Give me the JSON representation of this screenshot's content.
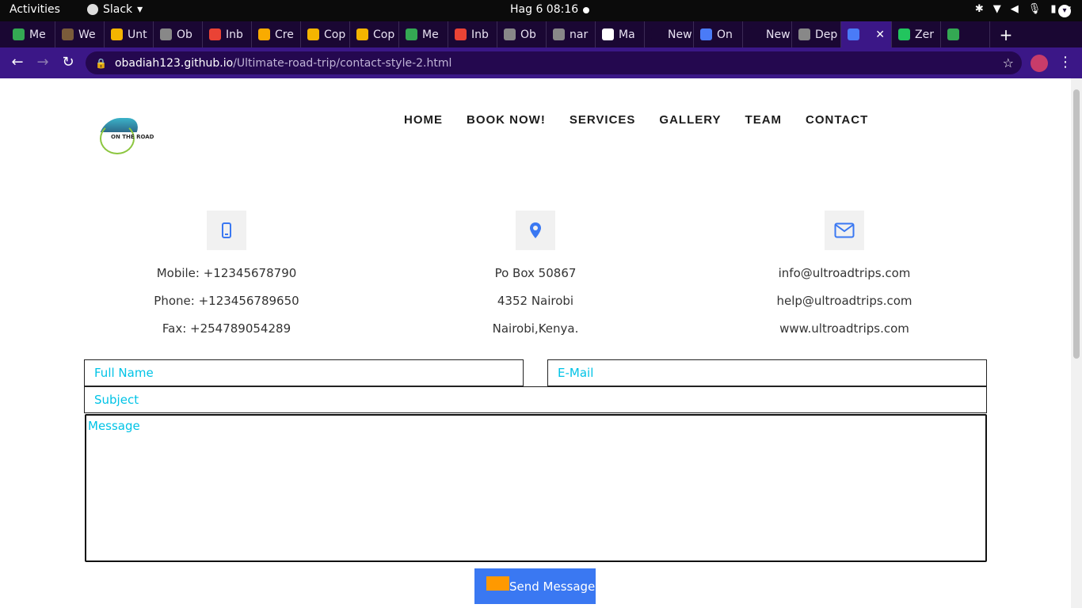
{
  "topbar": {
    "activities": "Activities",
    "app_name": "Slack",
    "clock": "Hag 6  08:16"
  },
  "tabs": [
    {
      "label": "Me",
      "color": "#34a853"
    },
    {
      "label": "We",
      "color": "#7a5b3a"
    },
    {
      "label": "Unt",
      "color": "#f4b400"
    },
    {
      "label": "Ob",
      "color": "#888888"
    },
    {
      "label": "Inb",
      "color": "#ea4335"
    },
    {
      "label": "Cre",
      "color": "#f9ab00"
    },
    {
      "label": "Cop",
      "color": "#f4b400"
    },
    {
      "label": "Cop",
      "color": "#f4b400"
    },
    {
      "label": "Me",
      "color": "#34a853"
    },
    {
      "label": "Inb",
      "color": "#ea4335"
    },
    {
      "label": "Ob",
      "color": "#888888"
    },
    {
      "label": "nar",
      "color": "#888888"
    },
    {
      "label": "Ma",
      "color": "#ffffff"
    },
    {
      "label": "New Ta",
      "color": "#1a0733"
    },
    {
      "label": "On",
      "color": "#4a7bf7"
    },
    {
      "label": "New Ta",
      "color": "#1a0733"
    },
    {
      "label": "Dep",
      "color": "#888888"
    },
    {
      "label": "",
      "color": "#4a7bf7",
      "active": true
    },
    {
      "label": "Zer",
      "color": "#22c55e"
    },
    {
      "label": "",
      "color": "#34a853"
    }
  ],
  "address": {
    "host": "obadiah123.github.io",
    "path": "/Ultimate-road-trip/contact-style-2.html"
  },
  "site": {
    "logo_text": "ON THE ROAD",
    "nav": [
      "HOME",
      "BOOK NOW!",
      "SERVICES",
      "GALLERY",
      "TEAM",
      "CONTACT"
    ],
    "contact_columns": [
      {
        "icon": "mobile-icon",
        "lines": [
          "Mobile: +12345678790",
          "Phone: +123456789650",
          "Fax: +254789054289"
        ]
      },
      {
        "icon": "map-marker-icon",
        "lines": [
          "Po Box 50867",
          "4352 Nairobi",
          "Nairobi,Kenya."
        ]
      },
      {
        "icon": "envelope-icon",
        "lines": [
          "info@ultroadtrips.com",
          "help@ultroadtrips.com",
          "www.ultroadtrips.com"
        ]
      }
    ],
    "form": {
      "full_name_placeholder": "Full Name",
      "email_placeholder": "E-Mail",
      "subject_placeholder": "Subject",
      "message_placeholder": "Message",
      "send_label": "Send Message"
    }
  },
  "colors": {
    "accent_blue": "#3a78f2",
    "placeholder_cyan": "#00c3e6",
    "browser_purple": "#3b1787"
  }
}
